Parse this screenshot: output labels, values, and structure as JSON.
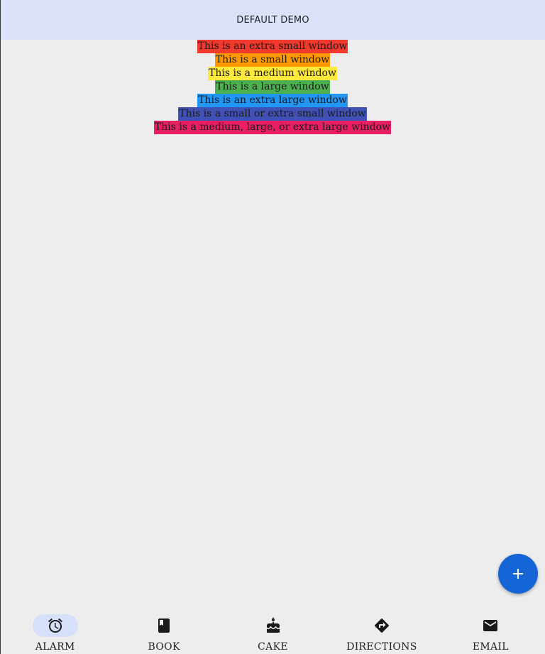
{
  "app_bar": {
    "title": "DEFAULT DEMO"
  },
  "window_lines": [
    {
      "text": "This is an extra small window",
      "color": "#f03a2e"
    },
    {
      "text": "This is a small window",
      "color": "#ff9800"
    },
    {
      "text": "This is a medium window",
      "color": "#ffe93b"
    },
    {
      "text": "This is a large window",
      "color": "#4caf50"
    },
    {
      "text": "This is an extra large window",
      "color": "#2196f3"
    },
    {
      "text": "This is a small or extra small window",
      "color": "#3f51b5"
    },
    {
      "text": "This is a medium, large, or extra large window",
      "color": "#e91e63"
    }
  ],
  "fab": {
    "icon": "plus-icon",
    "color": "#1565d8"
  },
  "nav": {
    "items": [
      {
        "label": "ALARM",
        "icon": "alarm-icon",
        "active": true
      },
      {
        "label": "BOOK",
        "icon": "book-icon",
        "active": false
      },
      {
        "label": "CAKE",
        "icon": "cake-icon",
        "active": false
      },
      {
        "label": "DIRECTIONS",
        "icon": "directions-icon",
        "active": false
      },
      {
        "label": "EMAIL",
        "icon": "email-icon",
        "active": false
      }
    ]
  }
}
